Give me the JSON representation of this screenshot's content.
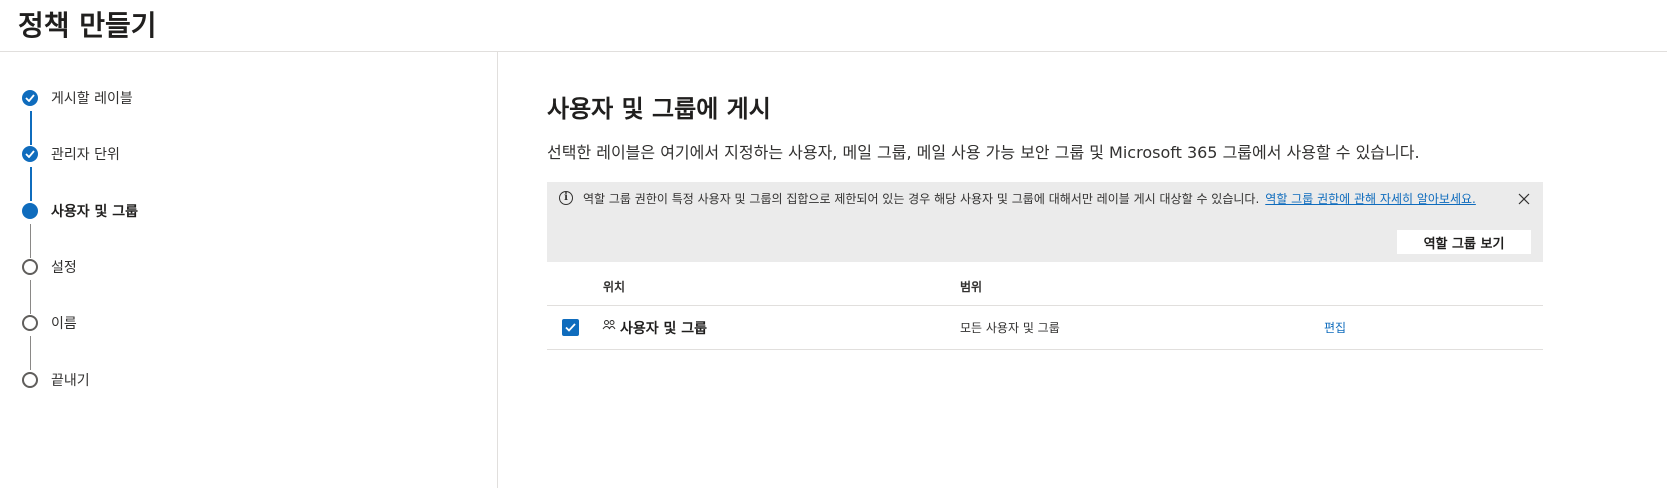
{
  "header": {
    "title": "정책 만들기"
  },
  "steps": [
    {
      "label": "게시할 레이블",
      "state": "done"
    },
    {
      "label": "관리자 단위",
      "state": "done"
    },
    {
      "label": "사용자 및 그룹",
      "state": "current"
    },
    {
      "label": "설정",
      "state": "todo"
    },
    {
      "label": "이름",
      "state": "todo"
    },
    {
      "label": "끝내기",
      "state": "todo"
    }
  ],
  "main": {
    "title": "사용자 및 그룹에 게시",
    "description": "선택한 레이블은 여기에서 지정하는 사용자, 메일 그룹, 메일 사용 가능 보안 그룹 및 Microsoft 365 그룹에서 사용할 수 있습니다."
  },
  "banner": {
    "text": "역할 그룹 권한이 특정 사용자 및 그룹의 집합으로 제한되어 있는 경우 해당 사용자 및 그룹에 대해서만 레이블 게시 대상할 수 있습니다.",
    "link": "역할 그룹 권한에 관해 자세히 알아보세요.",
    "button": "역할 그룹 보기",
    "info_icon": "info-icon",
    "close_icon": "close-icon"
  },
  "table": {
    "headers": {
      "location": "위치",
      "scope": "범위"
    },
    "rows": [
      {
        "checked": true,
        "icon": "people-icon",
        "name": "사용자 및 그룹",
        "scope": "모든 사용자 및 그룹",
        "action": "편집"
      }
    ]
  },
  "colors": {
    "accent": "#0f6cbd",
    "banner_bg": "#ebebeb",
    "text": "#323130"
  }
}
